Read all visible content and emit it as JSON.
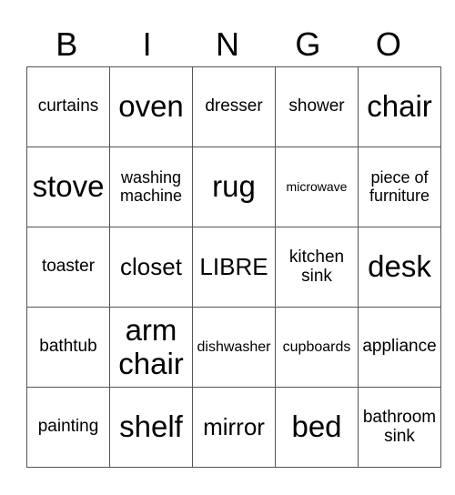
{
  "header": [
    "B",
    "I",
    "N",
    "G",
    "O"
  ],
  "rows": [
    [
      {
        "text": "curtains",
        "size": "s16"
      },
      {
        "text": "oven",
        "size": "s30"
      },
      {
        "text": "dresser",
        "size": "s16"
      },
      {
        "text": "shower",
        "size": "s16"
      },
      {
        "text": "chair",
        "size": "s30"
      }
    ],
    [
      {
        "text": "stove",
        "size": "s30"
      },
      {
        "text": "washing machine",
        "size": "s18"
      },
      {
        "text": "rug",
        "size": "s30"
      },
      {
        "text": "microwave",
        "size": "s15"
      },
      {
        "text": "piece of furniture",
        "size": "s18"
      }
    ],
    [
      {
        "text": "toaster",
        "size": "s16"
      },
      {
        "text": "closet",
        "size": "s24"
      },
      {
        "text": "LIBRE",
        "size": "s24"
      },
      {
        "text": "kitchen sink",
        "size": "s16"
      },
      {
        "text": "desk",
        "size": "s30"
      }
    ],
    [
      {
        "text": "bathtub",
        "size": "s16"
      },
      {
        "text": "arm chair",
        "size": "s30"
      },
      {
        "text": "dishwasher",
        "size": "s13"
      },
      {
        "text": "cupboards",
        "size": "s13"
      },
      {
        "text": "appliance",
        "size": "s16"
      }
    ],
    [
      {
        "text": "painting",
        "size": "s16"
      },
      {
        "text": "shelf",
        "size": "s30"
      },
      {
        "text": "mirror",
        "size": "s24"
      },
      {
        "text": "bed",
        "size": "s30"
      },
      {
        "text": "bathroom sink",
        "size": "s16"
      }
    ]
  ]
}
